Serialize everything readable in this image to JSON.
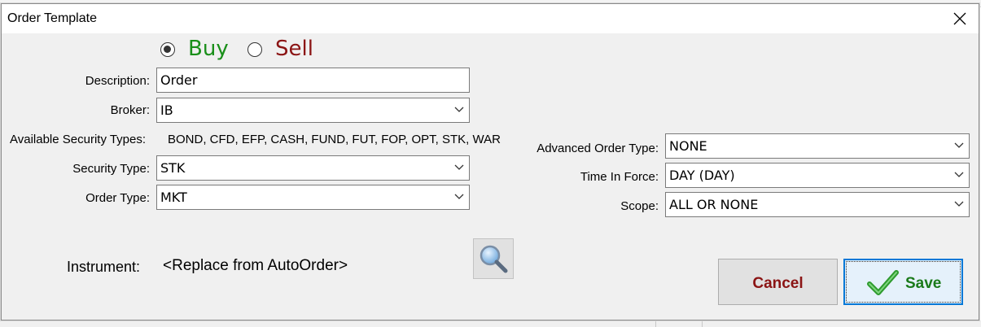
{
  "window": {
    "title": "Order Template"
  },
  "side": {
    "buy_label": "Buy",
    "sell_label": "Sell",
    "selected": "Buy",
    "buy_color": "#1a8f1a",
    "sell_color": "#8b1414"
  },
  "form": {
    "description": {
      "label": "Description:",
      "value": "Order"
    },
    "broker": {
      "label": "Broker:",
      "value": "IB"
    },
    "available_types": {
      "label": "Available Security Types:",
      "value": "BOND, CFD, EFP, CASH, FUND, FUT, FOP, OPT, STK, WAR"
    },
    "security_type": {
      "label": "Security Type:",
      "value": "STK"
    },
    "order_type": {
      "label": "Order Type:",
      "value": "MKT"
    },
    "advanced_order_type": {
      "label": "Advanced Order Type:",
      "value": "NONE"
    },
    "time_in_force": {
      "label": "Time In Force:",
      "value": "DAY (DAY)"
    },
    "scope": {
      "label": "Scope:",
      "value": "ALL OR NONE"
    },
    "instrument": {
      "label": "Instrument:",
      "value": "<Replace from AutoOrder>"
    }
  },
  "buttons": {
    "cancel": "Cancel",
    "save": "Save",
    "cancel_color": "#8b1414",
    "save_color": "#1a7a1a"
  },
  "icons": {
    "close": "close-icon",
    "search": "magnifier-icon",
    "check": "checkmark-icon",
    "chevron": "chevron-down-icon"
  }
}
